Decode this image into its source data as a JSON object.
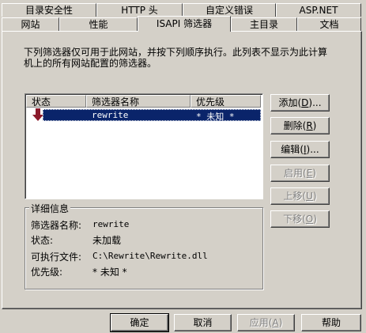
{
  "tabs_row1": [
    {
      "label": "目录安全性"
    },
    {
      "label": "HTTP 头"
    },
    {
      "label": "自定义错误"
    },
    {
      "label": "ASP.NET"
    }
  ],
  "tabs_row2": [
    {
      "label": "网站"
    },
    {
      "label": "性能"
    },
    {
      "label": "ISAPI 筛选器"
    },
    {
      "label": "主目录"
    },
    {
      "label": "文档"
    }
  ],
  "description": {
    "line1": "下列筛选器仅可用于此网站，并按下列顺序执行。此列表不显示为此计算",
    "line2": "机上的所有网站配置的筛选器。"
  },
  "filter_list": {
    "columns": [
      "状态",
      "筛选器名称",
      "优先级"
    ],
    "rows": [
      {
        "status_icon": "down-arrow-icon",
        "name": "rewrite",
        "priority": "* 未知 *"
      }
    ]
  },
  "side_buttons": {
    "add": {
      "text": "添加",
      "key": "D",
      "suffix": "..."
    },
    "remove": {
      "text": "删除",
      "key": "R",
      "suffix": ""
    },
    "edit": {
      "text": "编辑",
      "key": "I",
      "suffix": "..."
    },
    "enable": {
      "text": "启用",
      "key": "E",
      "suffix": ""
    },
    "move_up": {
      "text": "上移",
      "key": "U",
      "suffix": ""
    },
    "move_down": {
      "text": "下移",
      "key": "O",
      "suffix": ""
    }
  },
  "details": {
    "title": "详细信息",
    "name_label": "筛选器名称:",
    "name_value": "rewrite",
    "status_label": "状态:",
    "status_value": "未加载",
    "exe_label": "可执行文件:",
    "exe_value": "C:\\Rewrite\\Rewrite.dll",
    "priority_label": "优先级:",
    "priority_value": "* 未知 *"
  },
  "bottom_buttons": {
    "ok": "确定",
    "cancel": "取消",
    "apply": {
      "text": "应用",
      "key": "A"
    },
    "help": "帮助"
  },
  "colors": {
    "dialog_bg": "#d4d0c8",
    "selection_bg": "#0a246a",
    "arrow": "#8b1a2b"
  }
}
